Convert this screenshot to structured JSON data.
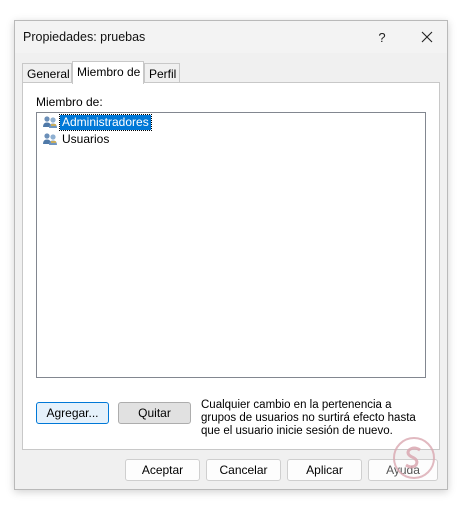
{
  "window": {
    "title": "Propiedades: pruebas",
    "help_label": "?",
    "close_icon": "close-icon"
  },
  "tabs": [
    {
      "label": "General",
      "active": false
    },
    {
      "label": "Miembro de",
      "active": true
    },
    {
      "label": "Perfil",
      "active": false
    }
  ],
  "member_of": {
    "label": "Miembro de:",
    "items": [
      {
        "name": "Administradores",
        "icon": "group-icon",
        "selected": true
      },
      {
        "name": "Usuarios",
        "icon": "group-icon",
        "selected": false
      }
    ]
  },
  "actions": {
    "add_label": "Agregar...",
    "remove_label": "Quitar",
    "info_text": "Cualquier cambio en la pertenencia a grupos de usuarios no surtirá efecto hasta que el usuario inicie sesión de nuevo."
  },
  "footer": {
    "ok_label": "Aceptar",
    "cancel_label": "Cancelar",
    "apply_label": "Aplicar",
    "help_label": "Ayuda"
  },
  "colors": {
    "selection": "#0078d7",
    "dialog_bg": "#f0f0f0"
  }
}
